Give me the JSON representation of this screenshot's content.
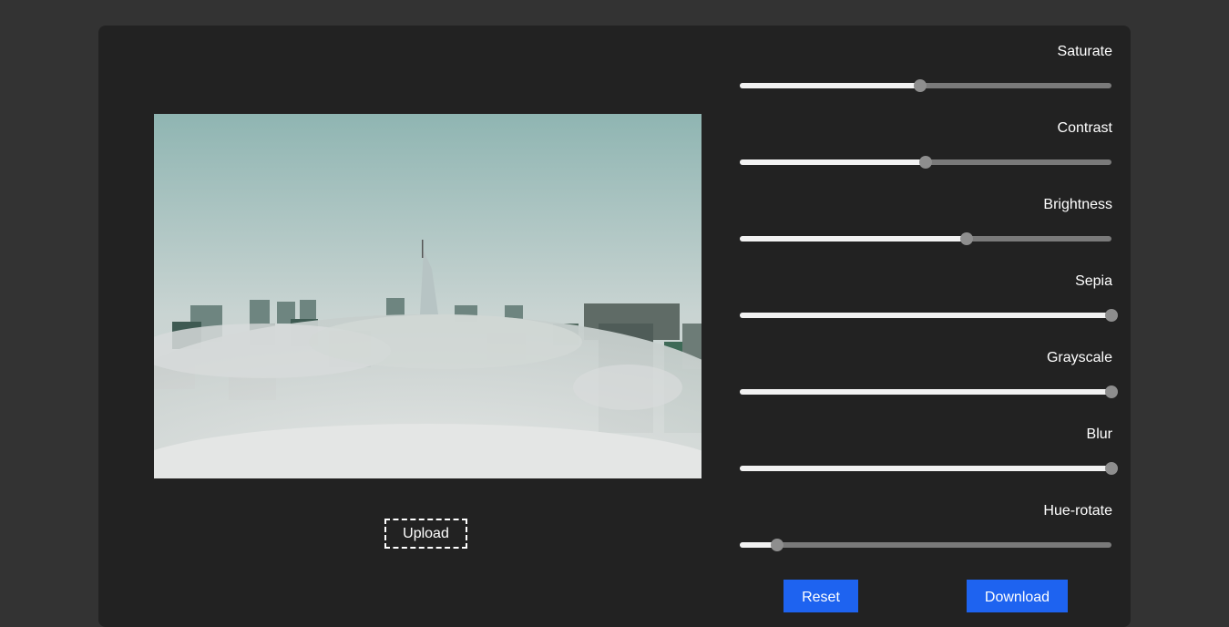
{
  "upload": {
    "label": "Upload"
  },
  "sliders": [
    {
      "label": "Saturate",
      "value": 0.485
    },
    {
      "label": "Contrast",
      "value": 0.5
    },
    {
      "label": "Brightness",
      "value": 0.61
    },
    {
      "label": "Sepia",
      "value": 1.0
    },
    {
      "label": "Grayscale",
      "value": 1.0
    },
    {
      "label": "Blur",
      "value": 1.0
    },
    {
      "label": "Hue-rotate",
      "value": 0.1
    }
  ],
  "actions": {
    "reset_label": "Reset",
    "download_label": "Download"
  },
  "colors": {
    "accent": "#1e63f0",
    "panel": "#222222",
    "background": "#333333"
  }
}
